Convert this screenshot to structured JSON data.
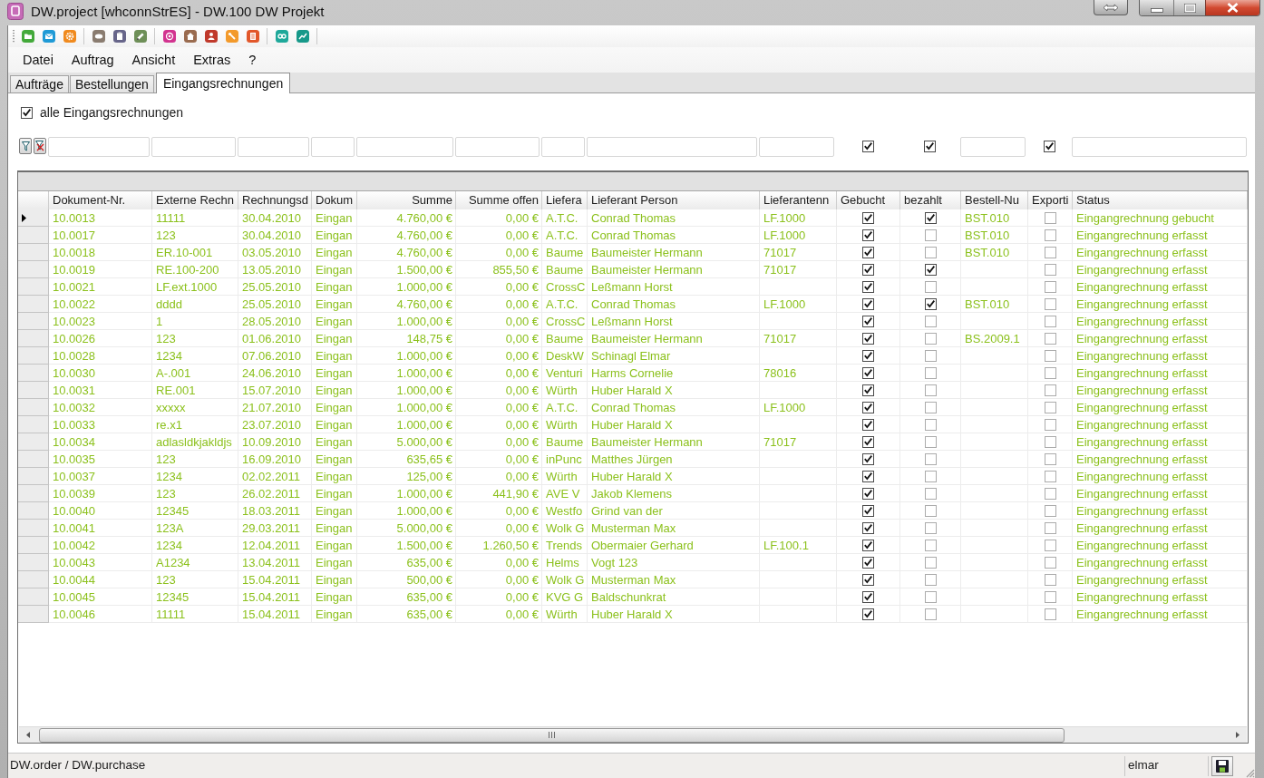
{
  "window": {
    "title": "DW.project [whconnStrES] - DW.100 DW Projekt"
  },
  "menu": [
    "Datei",
    "Auftrag",
    "Ansicht",
    "Extras",
    "?"
  ],
  "tabs": [
    {
      "label": "Aufträge",
      "selected": false
    },
    {
      "label": "Bestellungen",
      "selected": false
    },
    {
      "label": "Eingangsrechnungen",
      "selected": true
    }
  ],
  "filter_checkbox": {
    "label": "alle Eingangsrechnungen",
    "checked": true
  },
  "filter_row": {
    "cells": [
      {
        "kind": "input"
      },
      {
        "kind": "input"
      },
      {
        "kind": "input"
      },
      {
        "kind": "input"
      },
      {
        "kind": "input"
      },
      {
        "kind": "input"
      },
      {
        "kind": "input"
      },
      {
        "kind": "input"
      },
      {
        "kind": "input"
      },
      {
        "kind": "checkbox",
        "checked": true
      },
      {
        "kind": "checkbox",
        "checked": true
      },
      {
        "kind": "input"
      },
      {
        "kind": "checkbox",
        "checked": true
      },
      {
        "kind": "input"
      }
    ]
  },
  "table": {
    "columns": [
      {
        "label": "Dokument-Nr.",
        "kind": "text"
      },
      {
        "label": "Externe Rechn",
        "kind": "text"
      },
      {
        "label": "Rechnungsd",
        "kind": "text"
      },
      {
        "label": "Dokum",
        "kind": "text"
      },
      {
        "label": "Summe",
        "kind": "amount"
      },
      {
        "label": "Summe offen",
        "kind": "amount"
      },
      {
        "label": "Liefera",
        "kind": "text"
      },
      {
        "label": "Lieferant Person",
        "kind": "text"
      },
      {
        "label": "Lieferantenn",
        "kind": "text"
      },
      {
        "label": "Gebucht",
        "kind": "check"
      },
      {
        "label": "bezahlt",
        "kind": "check"
      },
      {
        "label": "Bestell-Nu",
        "kind": "text"
      },
      {
        "label": "Exporti",
        "kind": "check"
      },
      {
        "label": "Status",
        "kind": "text"
      }
    ],
    "rows": [
      {
        "selected": true,
        "cells": [
          "10.0013",
          "11111",
          "30.04.2010",
          "Eingan",
          "4.760,00 €",
          "0,00 €",
          "A.T.C.",
          "Conrad Thomas",
          "LF.1000",
          {
            "checked": true
          },
          {
            "checked": true
          },
          "BST.010",
          {
            "checked": false
          },
          "Eingangrechnung gebucht"
        ]
      },
      {
        "selected": false,
        "cells": [
          "10.0017",
          "123",
          "30.04.2010",
          "Eingan",
          "4.760,00 €",
          "0,00 €",
          "A.T.C.",
          "Conrad Thomas",
          "LF.1000",
          {
            "checked": true
          },
          {
            "checked": false
          },
          "BST.010",
          {
            "checked": false
          },
          "Eingangrechnung erfasst"
        ]
      },
      {
        "selected": false,
        "cells": [
          "10.0018",
          "ER.10-001",
          "03.05.2010",
          "Eingan",
          "4.760,00 €",
          "0,00 €",
          "Baume",
          "Baumeister Hermann",
          "71017",
          {
            "checked": true
          },
          {
            "checked": false
          },
          "BST.010",
          {
            "checked": false
          },
          "Eingangrechnung erfasst"
        ]
      },
      {
        "selected": false,
        "cells": [
          "10.0019",
          "RE.100-200",
          "13.05.2010",
          "Eingan",
          "1.500,00 €",
          "855,50 €",
          "Baume",
          "Baumeister Hermann",
          "71017",
          {
            "checked": true
          },
          {
            "checked": true
          },
          null,
          {
            "checked": false
          },
          "Eingangrechnung erfasst"
        ]
      },
      {
        "selected": false,
        "cells": [
          "10.0021",
          "LF.ext.1000",
          "25.05.2010",
          "Eingan",
          "1.000,00 €",
          "0,00 €",
          "CrossC",
          "Leßmann Horst",
          null,
          {
            "checked": true
          },
          {
            "checked": false
          },
          null,
          {
            "checked": false
          },
          "Eingangrechnung erfasst"
        ]
      },
      {
        "selected": false,
        "cells": [
          "10.0022",
          "dddd",
          "25.05.2010",
          "Eingan",
          "4.760,00 €",
          "0,00 €",
          "A.T.C.",
          "Conrad Thomas",
          "LF.1000",
          {
            "checked": true
          },
          {
            "checked": true
          },
          "BST.010",
          {
            "checked": false
          },
          "Eingangrechnung erfasst"
        ]
      },
      {
        "selected": false,
        "cells": [
          "10.0023",
          "1",
          "28.05.2010",
          "Eingan",
          "1.000,00 €",
          "0,00 €",
          "CrossC",
          "Leßmann Horst",
          null,
          {
            "checked": true
          },
          {
            "checked": false
          },
          null,
          {
            "checked": false
          },
          "Eingangrechnung erfasst"
        ]
      },
      {
        "selected": false,
        "cells": [
          "10.0026",
          "123",
          "01.06.2010",
          "Eingan",
          "148,75 €",
          "0,00 €",
          "Baume",
          "Baumeister Hermann",
          "71017",
          {
            "checked": true
          },
          {
            "checked": false
          },
          "BS.2009.1",
          {
            "checked": false
          },
          "Eingangrechnung erfasst"
        ]
      },
      {
        "selected": false,
        "cells": [
          "10.0028",
          "1234",
          "07.06.2010",
          "Eingan",
          "1.000,00 €",
          "0,00 €",
          "DeskW",
          "Schinagl Elmar",
          null,
          {
            "checked": true
          },
          {
            "checked": false
          },
          null,
          {
            "checked": false
          },
          "Eingangrechnung erfasst"
        ]
      },
      {
        "selected": false,
        "cells": [
          "10.0030",
          "A-.001",
          "24.06.2010",
          "Eingan",
          "1.000,00 €",
          "0,00 €",
          "Venturi",
          "Harms Cornelie",
          "78016",
          {
            "checked": true
          },
          {
            "checked": false
          },
          null,
          {
            "checked": false
          },
          "Eingangrechnung erfasst"
        ]
      },
      {
        "selected": false,
        "cells": [
          "10.0031",
          "RE.001",
          "15.07.2010",
          "Eingan",
          "1.000,00 €",
          "0,00 €",
          "Würth",
          "Huber Harald X",
          null,
          {
            "checked": true
          },
          {
            "checked": false
          },
          null,
          {
            "checked": false
          },
          "Eingangrechnung erfasst"
        ]
      },
      {
        "selected": false,
        "cells": [
          "10.0032",
          "xxxxx",
          "21.07.2010",
          "Eingan",
          "1.000,00 €",
          "0,00 €",
          "A.T.C.",
          "Conrad Thomas",
          "LF.1000",
          {
            "checked": true
          },
          {
            "checked": false
          },
          null,
          {
            "checked": false
          },
          "Eingangrechnung erfasst"
        ]
      },
      {
        "selected": false,
        "cells": [
          "10.0033",
          "re.x1",
          "23.07.2010",
          "Eingan",
          "1.000,00 €",
          "0,00 €",
          "Würth",
          "Huber Harald X",
          null,
          {
            "checked": true
          },
          {
            "checked": false
          },
          null,
          {
            "checked": false
          },
          "Eingangrechnung erfasst"
        ]
      },
      {
        "selected": false,
        "cells": [
          "10.0034",
          "adlasldkjakldjs",
          "10.09.2010",
          "Eingan",
          "5.000,00 €",
          "0,00 €",
          "Baume",
          "Baumeister Hermann",
          "71017",
          {
            "checked": true
          },
          {
            "checked": false
          },
          null,
          {
            "checked": false
          },
          "Eingangrechnung erfasst"
        ]
      },
      {
        "selected": false,
        "cells": [
          "10.0035",
          "123",
          "16.09.2010",
          "Eingan",
          "635,65 €",
          "0,00 €",
          "inPunc",
          "Matthes Jürgen",
          null,
          {
            "checked": true
          },
          {
            "checked": false
          },
          null,
          {
            "checked": false
          },
          "Eingangrechnung erfasst"
        ]
      },
      {
        "selected": false,
        "cells": [
          "10.0037",
          "1234",
          "02.02.2011",
          "Eingan",
          "125,00 €",
          "0,00 €",
          "Würth",
          "Huber Harald X",
          null,
          {
            "checked": true
          },
          {
            "checked": false
          },
          null,
          {
            "checked": false
          },
          "Eingangrechnung erfasst"
        ]
      },
      {
        "selected": false,
        "cells": [
          "10.0039",
          "123",
          "26.02.2011",
          "Eingan",
          "1.000,00 €",
          "441,90 €",
          "AVE V",
          "Jakob Klemens",
          null,
          {
            "checked": true
          },
          {
            "checked": false
          },
          null,
          {
            "checked": false
          },
          "Eingangrechnung erfasst"
        ]
      },
      {
        "selected": false,
        "cells": [
          "10.0040",
          "12345",
          "18.03.2011",
          "Eingan",
          "1.000,00 €",
          "0,00 €",
          "Westfo",
          "Grind van der",
          null,
          {
            "checked": true
          },
          {
            "checked": false
          },
          null,
          {
            "checked": false
          },
          "Eingangrechnung erfasst"
        ]
      },
      {
        "selected": false,
        "cells": [
          "10.0041",
          "123A",
          "29.03.2011",
          "Eingan",
          "5.000,00 €",
          "0,00 €",
          "Wolk G",
          "Musterman Max",
          null,
          {
            "checked": true
          },
          {
            "checked": false
          },
          null,
          {
            "checked": false
          },
          "Eingangrechnung erfasst"
        ]
      },
      {
        "selected": false,
        "cells": [
          "10.0042",
          "1234",
          "12.04.2011",
          "Eingan",
          "1.500,00 €",
          "1.260,50 €",
          "Trends",
          "Obermaier Gerhard",
          "LF.100.1",
          {
            "checked": true
          },
          {
            "checked": false
          },
          null,
          {
            "checked": false
          },
          "Eingangrechnung erfasst"
        ]
      },
      {
        "selected": false,
        "cells": [
          "10.0043",
          "A1234",
          "13.04.2011",
          "Eingan",
          "635,00 €",
          "0,00 €",
          "Helms",
          "Vogt 123",
          null,
          {
            "checked": true
          },
          {
            "checked": false
          },
          null,
          {
            "checked": false
          },
          "Eingangrechnung erfasst"
        ]
      },
      {
        "selected": false,
        "cells": [
          "10.0044",
          "123",
          "15.04.2011",
          "Eingan",
          "500,00 €",
          "0,00 €",
          "Wolk G",
          "Musterman Max",
          null,
          {
            "checked": true
          },
          {
            "checked": false
          },
          null,
          {
            "checked": false
          },
          "Eingangrechnung erfasst"
        ]
      },
      {
        "selected": false,
        "cells": [
          "10.0045",
          "12345",
          "15.04.2011",
          "Eingan",
          "635,00 €",
          "0,00 €",
          "KVG G",
          "Baldschunkrat",
          null,
          {
            "checked": true
          },
          {
            "checked": false
          },
          null,
          {
            "checked": false
          },
          "Eingangrechnung erfasst"
        ]
      },
      {
        "selected": false,
        "cells": [
          "10.0046",
          "11111",
          "15.04.2011",
          "Eingan",
          "635,00 €",
          "0,00 €",
          "Würth",
          "Huber Harald X",
          null,
          {
            "checked": true
          },
          {
            "checked": false
          },
          null,
          {
            "checked": false
          },
          "Eingangrechnung erfasst"
        ]
      }
    ]
  },
  "status_bar": {
    "sections": [
      "DW.order / DW.purchase",
      "elmar"
    ]
  }
}
